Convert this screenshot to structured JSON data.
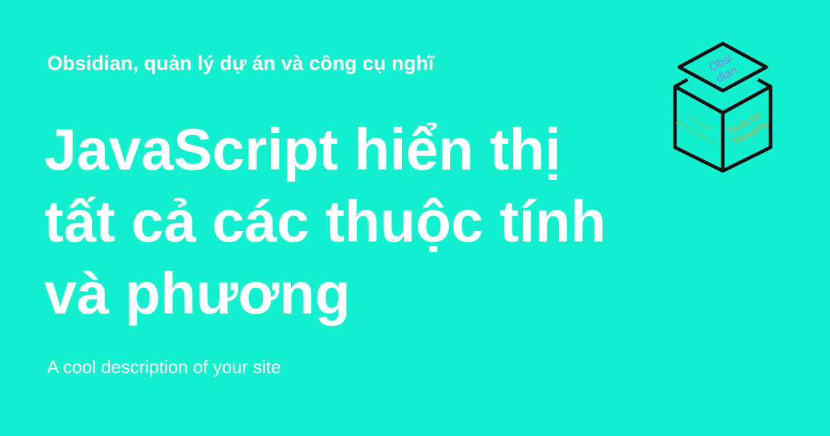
{
  "brand": {
    "background": "#12f0d0",
    "text_color": "#ffffff"
  },
  "site_name": "Obsidian, quản lý dự án và công cụ nghĩ",
  "title": "JavaScript hiển thị tất cả các thuộc tính và phương",
  "description": "A cool description of your site",
  "logo": {
    "icon": "obsidian-cube-logo",
    "top_text_line1": "Obsi",
    "top_text_line2": "dian",
    "left_text_line1": "Project",
    "left_text_line2": "Management",
    "right_text_line1": "Tools for",
    "right_text_line2": "Thoughts",
    "top_text_color": "#8a7fe0",
    "left_text_color": "#5ad07a",
    "right_text_color": "#c9a84a"
  }
}
